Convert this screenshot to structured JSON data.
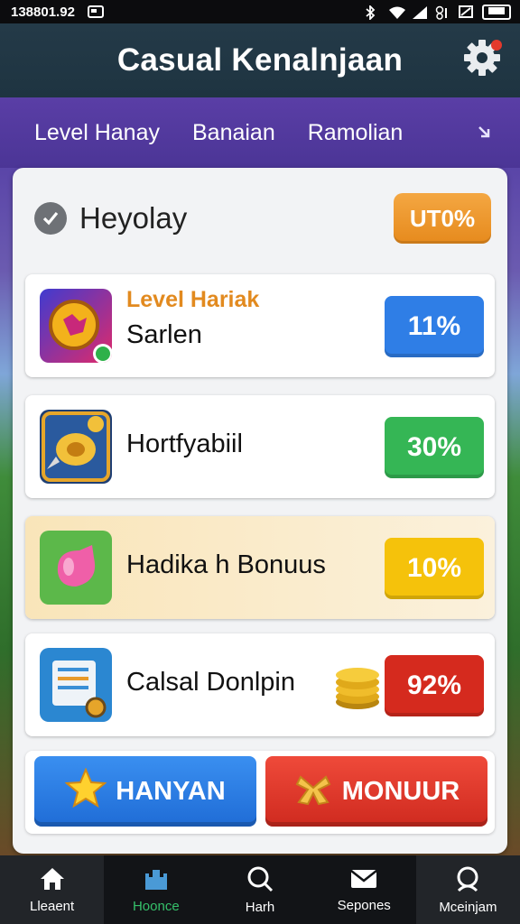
{
  "status_bar": {
    "time": "138801.92"
  },
  "header": {
    "title": "Casual Kenalnjaan"
  },
  "tabs": [
    {
      "label": "Level Hanay"
    },
    {
      "label": "Banaian"
    },
    {
      "label": "Ramolian"
    }
  ],
  "panel": {
    "title": "Heyolay",
    "badge": "UT0%"
  },
  "rows": [
    {
      "subtitle": "Level Hariak",
      "title": "Sarlen",
      "badge": "11%",
      "badge_color": "#2f7ee6"
    },
    {
      "subtitle": "",
      "title": "Hortfyabiil",
      "badge": "30%",
      "badge_color": "#35b655"
    },
    {
      "subtitle": "",
      "title": "Hadika h Bonuus",
      "badge": "10%",
      "badge_color": "#f5c20b"
    },
    {
      "subtitle": "",
      "title": "Calsal Donlpin",
      "badge": "92%",
      "badge_color": "#d52a1e"
    }
  ],
  "buttons": {
    "left": "HANYAN",
    "right": "MONUUR"
  },
  "nav": [
    {
      "label": "Lleaent",
      "icon": "home-icon"
    },
    {
      "label": "Hoonce",
      "icon": "castle-icon"
    },
    {
      "label": "Harh",
      "icon": "search-icon"
    },
    {
      "label": "Sepones",
      "icon": "mail-icon"
    },
    {
      "label": "Mceinjam",
      "icon": "profile-icon"
    }
  ],
  "colors": {
    "header": "#1e3441",
    "tabs": "#4b3596",
    "accent_orange": "#e68a1d",
    "nav_selected": "#35c06a"
  }
}
